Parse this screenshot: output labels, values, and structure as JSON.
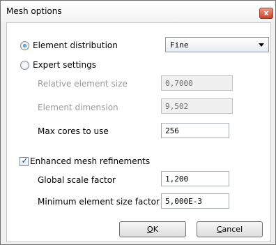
{
  "window": {
    "title": "Mesh options",
    "close_glyph": "x"
  },
  "distribution": {
    "radio_label": "Element distribution",
    "selected": "Fine",
    "options": [
      "Fine"
    ]
  },
  "expert": {
    "radio_label": "Expert settings",
    "relative_size_label": "Relative element size",
    "relative_size_value": "0,7000",
    "dimension_label": "Element dimension",
    "dimension_value": "9,502"
  },
  "cores": {
    "label": "Max cores to use",
    "value": "256"
  },
  "refinements": {
    "checkbox_label": "Enhanced mesh refinements",
    "checked": true,
    "check_glyph": "✓",
    "global_scale_label": "Global scale factor",
    "global_scale_value": "1,200",
    "min_element_label": "Minimum element size factor",
    "min_element_value": "5,000E-3"
  },
  "buttons": {
    "ok_mnemonic": "O",
    "ok_rest": "K",
    "cancel_mnemonic": "C",
    "cancel_rest": "ancel"
  },
  "icons": {
    "close": "close-icon",
    "dropdown": "chevron-down-icon",
    "check": "check-icon"
  }
}
